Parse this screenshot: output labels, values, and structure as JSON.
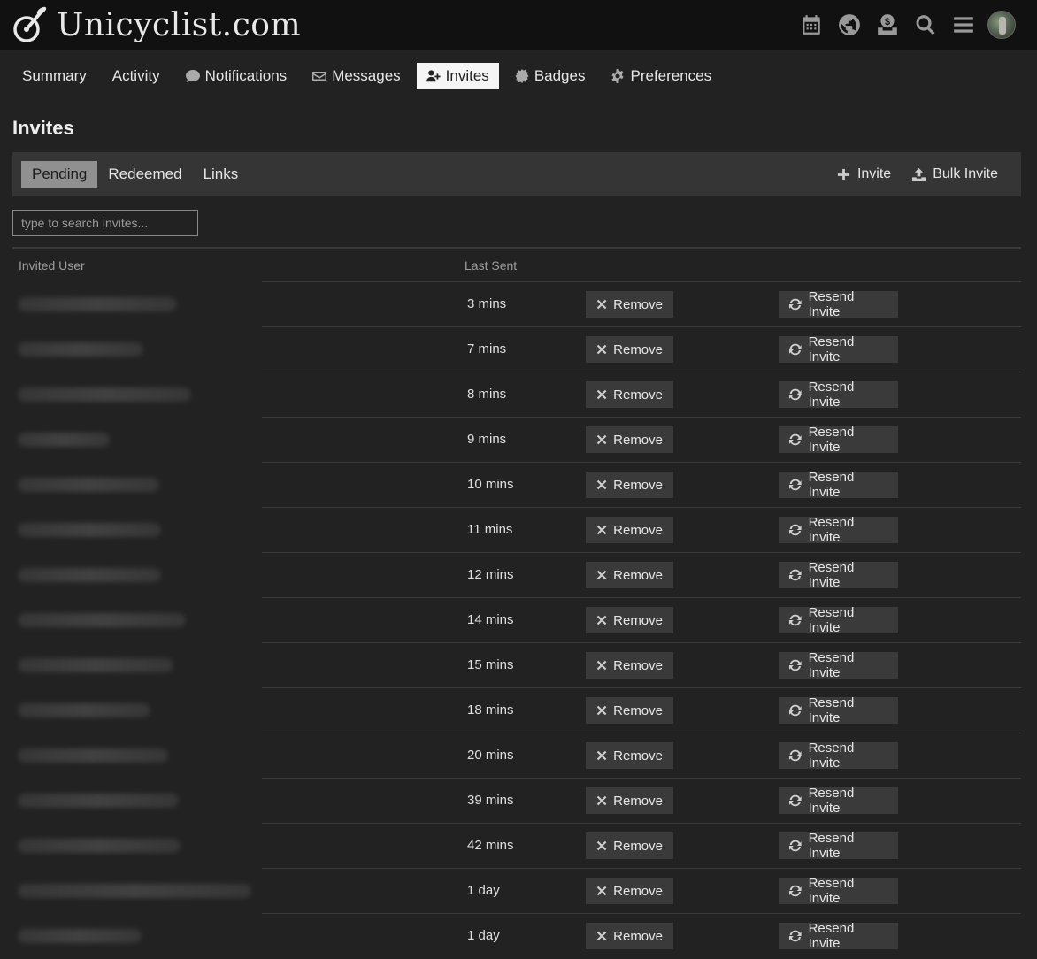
{
  "site": {
    "name": "Unicyclist.com"
  },
  "header_icons": [
    "calendar-icon",
    "globe-icon",
    "donate-icon",
    "search-icon",
    "hamburger-menu-icon"
  ],
  "nav": {
    "summary": "Summary",
    "activity": "Activity",
    "notifications": "Notifications",
    "messages": "Messages",
    "invites": "Invites",
    "badges": "Badges",
    "preferences": "Preferences",
    "active": "invites"
  },
  "page": {
    "title": "Invites"
  },
  "tabs": {
    "pending": "Pending",
    "redeemed": "Redeemed",
    "links": "Links",
    "active": "pending"
  },
  "actions": {
    "invite": "Invite",
    "bulk_invite": "Bulk Invite"
  },
  "search": {
    "placeholder": "type to search invites..."
  },
  "table": {
    "headers": {
      "invited_user": "Invited User",
      "last_sent": "Last Sent"
    },
    "remove_label": "Remove",
    "resend_label": "Resend Invite",
    "rows": [
      {
        "last_sent": "3 mins"
      },
      {
        "last_sent": "7 mins"
      },
      {
        "last_sent": "8 mins"
      },
      {
        "last_sent": "9 mins"
      },
      {
        "last_sent": "10 mins"
      },
      {
        "last_sent": "11 mins"
      },
      {
        "last_sent": "12 mins"
      },
      {
        "last_sent": "14 mins"
      },
      {
        "last_sent": "15 mins"
      },
      {
        "last_sent": "18 mins"
      },
      {
        "last_sent": "20 mins"
      },
      {
        "last_sent": "39 mins"
      },
      {
        "last_sent": "42 mins"
      },
      {
        "last_sent": "1 day"
      },
      {
        "last_sent": "1 day"
      }
    ]
  },
  "colors": {
    "background": "#222222",
    "header": "#111111",
    "active_nav": "#f5f5f5",
    "active_tab": "#909090",
    "button": "#3a3a3a"
  }
}
